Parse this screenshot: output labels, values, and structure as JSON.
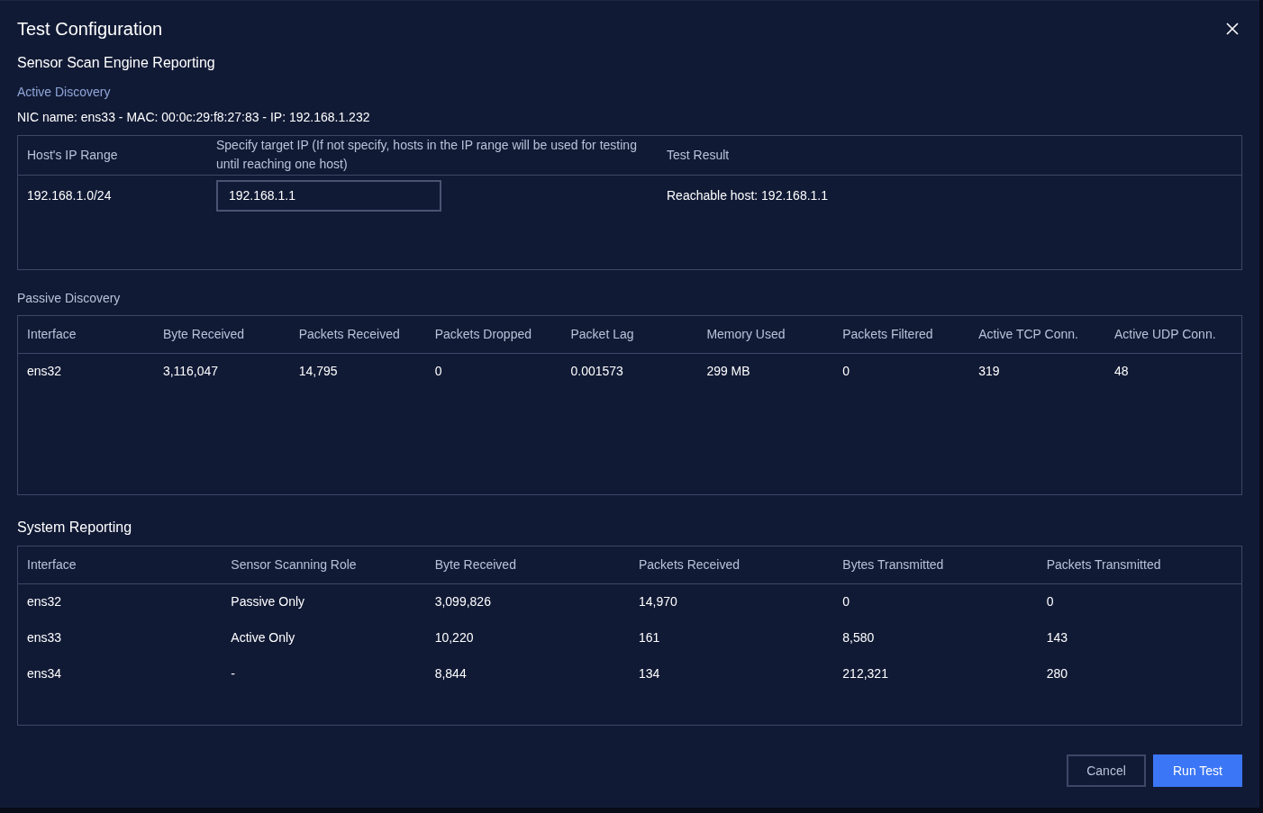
{
  "dialog": {
    "title": "Test Configuration"
  },
  "section_title": "Sensor Scan Engine Reporting",
  "active_discovery": {
    "label": "Active Discovery",
    "nic_info": "NIC name: ens33 - MAC: 00:0c:29:f8:27:83 - IP: 192.168.1.232",
    "columns": [
      "Host's IP Range",
      "Specify target IP (If not specify, hosts in the IP range will be used for testing until reaching one host)",
      "Test Result"
    ],
    "rows": [
      {
        "ip_range": "192.168.1.0/24",
        "target_ip": "192.168.1.1",
        "result": "Reachable host: 192.168.1.1"
      }
    ]
  },
  "passive_discovery": {
    "label": "Passive Discovery",
    "columns": [
      "Interface",
      "Byte Received",
      "Packets Received",
      "Packets Dropped",
      "Packet Lag",
      "Memory Used",
      "Packets Filtered",
      "Active TCP Conn.",
      "Active UDP Conn."
    ],
    "rows": [
      [
        "ens32",
        "3,116,047",
        "14,795",
        "0",
        "0.001573",
        "299 MB",
        "0",
        "319",
        "48"
      ]
    ]
  },
  "system_reporting": {
    "title": "System Reporting",
    "columns": [
      "Interface",
      "Sensor Scanning Role",
      "Byte Received",
      "Packets Received",
      "Bytes Transmitted",
      "Packets Transmitted"
    ],
    "rows": [
      [
        "ens32",
        "Passive Only",
        "3,099,826",
        "14,970",
        "0",
        "0"
      ],
      [
        "ens33",
        "Active Only",
        "10,220",
        "161",
        "8,580",
        "143"
      ],
      [
        "ens34",
        "-",
        "8,844",
        "134",
        "212,321",
        "280"
      ]
    ]
  },
  "buttons": [
    {
      "label": "Cancel",
      "kind": "secondary"
    },
    {
      "label": "Run Test",
      "kind": "primary"
    }
  ]
}
